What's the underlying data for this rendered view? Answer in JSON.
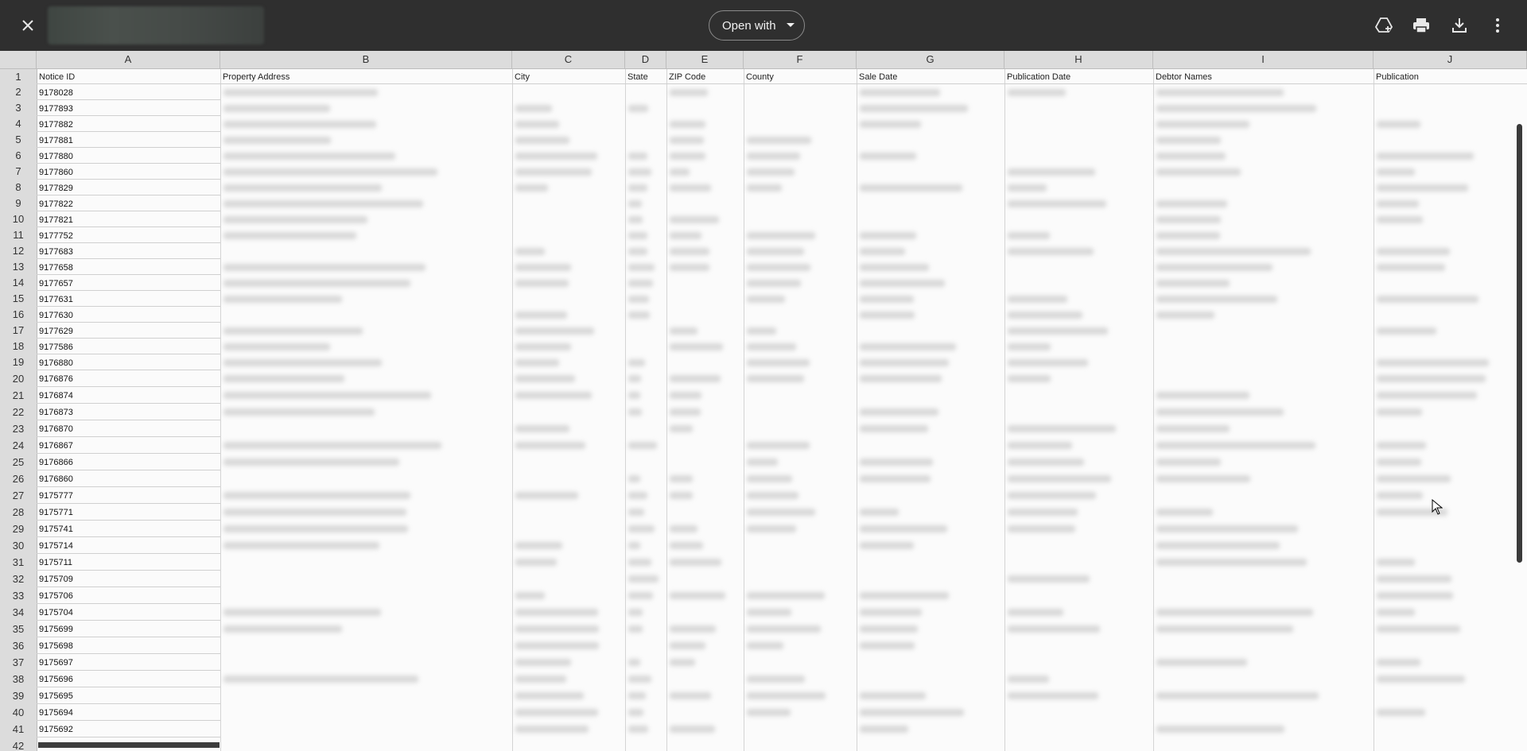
{
  "toolbar": {
    "open_with_label": "Open with",
    "icons": [
      "close-icon",
      "add-to-drive-icon",
      "print-icon",
      "download-icon",
      "more-vert-icon"
    ]
  },
  "sheet": {
    "columns": [
      "A",
      "B",
      "C",
      "D",
      "E",
      "F",
      "G",
      "H",
      "I",
      "J"
    ],
    "header_row": [
      "Notice ID",
      "Property Address",
      "City",
      "State",
      "ZIP Code",
      "County",
      "Sale Date",
      "Publication Date",
      "Debtor Names",
      "Publication"
    ],
    "row_numbers": [
      "1",
      "2",
      "3",
      "4",
      "5",
      "6",
      "7",
      "8",
      "9",
      "10",
      "11",
      "12",
      "13",
      "14",
      "15",
      "16",
      "17",
      "18",
      "19",
      "20",
      "21",
      "22",
      "23",
      "24",
      "25",
      "26",
      "27",
      "28",
      "29",
      "30",
      "31",
      "32",
      "33",
      "34",
      "35",
      "36",
      "37",
      "38",
      "39",
      "40",
      "41",
      "42"
    ],
    "notice_ids": [
      "9178028",
      "9177893",
      "9177882",
      "9177881",
      "9177880",
      "9177860",
      "9177829",
      "9177822",
      "9177821",
      "9177752",
      "9177683",
      "9177658",
      "9177657",
      "9177631",
      "9177630",
      "9177629",
      "9177586",
      "9176880",
      "9176876",
      "9176874",
      "9176873",
      "9176870",
      "9176867",
      "9176866",
      "9176860",
      "9175777",
      "9175771",
      "9175741",
      "9175714",
      "9175711",
      "9175709",
      "9175706",
      "9175704",
      "9175699",
      "9175698",
      "9175697",
      "9175696",
      "9175695",
      "9175694",
      "9175692"
    ]
  },
  "colors": {
    "topbar": "#2f2f2f",
    "sheet_bg": "#fbfbfb",
    "header_bg": "#dcdcdc"
  }
}
